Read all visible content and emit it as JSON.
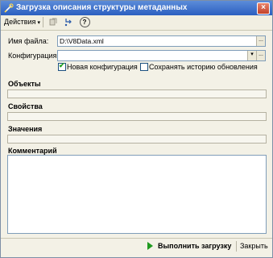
{
  "window": {
    "title": "Загрузка описания структуры метаданных",
    "close_glyph": "×"
  },
  "toolbar": {
    "actions_label": "Действия",
    "actions_caret": "▾",
    "help_glyph": "?"
  },
  "form": {
    "file_label": "Имя файла:",
    "file_value": "D:\\V8Data.xml",
    "file_button": "...",
    "config_label": "Конфигурация:",
    "config_value": "",
    "config_dropdown": "▾",
    "config_button": "...",
    "new_config": {
      "label": "Новая конфигурация",
      "checked": true
    },
    "save_history": {
      "label": "Сохранять историю обновления",
      "checked": false
    }
  },
  "sections": {
    "objects": "Объекты",
    "properties": "Свойства",
    "values": "Значения",
    "comment": "Комментарий"
  },
  "footer": {
    "run_label": "Выполнить загрузку",
    "close_label": "Закрыть"
  },
  "colors": {
    "accent": "#2b5fc0",
    "run_arrow": "#1f9a1f"
  },
  "icons": {
    "title": "config-tool-icon",
    "toolbar_1": "refresh-icon",
    "toolbar_2": "info-flow-icon",
    "toolbar_3": "help-icon"
  }
}
